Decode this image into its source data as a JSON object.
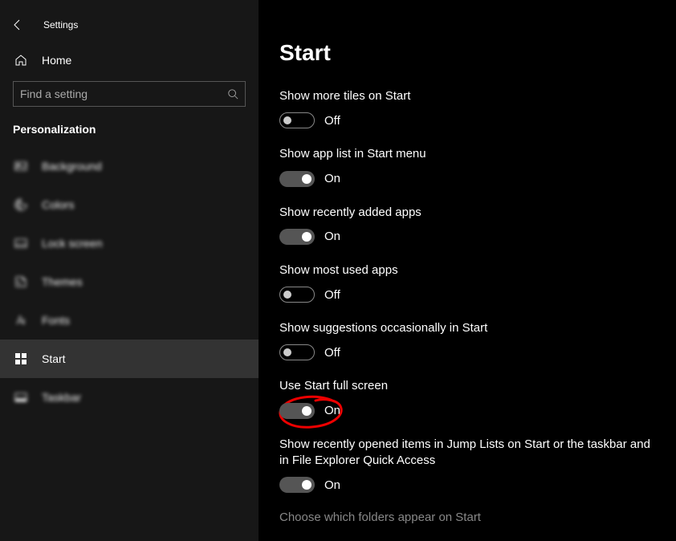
{
  "app_title": "Settings",
  "home_label": "Home",
  "search_placeholder": "Find a setting",
  "section_header": "Personalization",
  "nav": [
    {
      "key": "background",
      "label": "Background",
      "selected": false,
      "blurred": true
    },
    {
      "key": "colors",
      "label": "Colors",
      "selected": false,
      "blurred": true
    },
    {
      "key": "lockscreen",
      "label": "Lock screen",
      "selected": false,
      "blurred": true
    },
    {
      "key": "themes",
      "label": "Themes",
      "selected": false,
      "blurred": true
    },
    {
      "key": "fonts",
      "label": "Fonts",
      "selected": false,
      "blurred": true
    },
    {
      "key": "start",
      "label": "Start",
      "selected": true,
      "blurred": false
    },
    {
      "key": "taskbar",
      "label": "Taskbar",
      "selected": false,
      "blurred": true
    }
  ],
  "page_title": "Start",
  "settings": [
    {
      "key": "more-tiles",
      "label": "Show more tiles on Start",
      "state": "off",
      "text": "Off",
      "annotated": false
    },
    {
      "key": "app-list",
      "label": "Show app list in Start menu",
      "state": "on",
      "text": "On",
      "annotated": false
    },
    {
      "key": "recently-added",
      "label": "Show recently added apps",
      "state": "on",
      "text": "On",
      "annotated": false
    },
    {
      "key": "most-used",
      "label": "Show most used apps",
      "state": "off",
      "text": "Off",
      "annotated": false
    },
    {
      "key": "suggestions",
      "label": "Show suggestions occasionally in Start",
      "state": "off",
      "text": "Off",
      "annotated": false
    },
    {
      "key": "full-screen",
      "label": "Use Start full screen",
      "state": "on",
      "text": "On",
      "annotated": true
    },
    {
      "key": "jump-lists",
      "label": "Show recently opened items in Jump Lists on Start or the taskbar and in File Explorer Quick Access",
      "state": "on",
      "text": "On",
      "annotated": false
    }
  ],
  "footer_link": "Choose which folders appear on Start"
}
